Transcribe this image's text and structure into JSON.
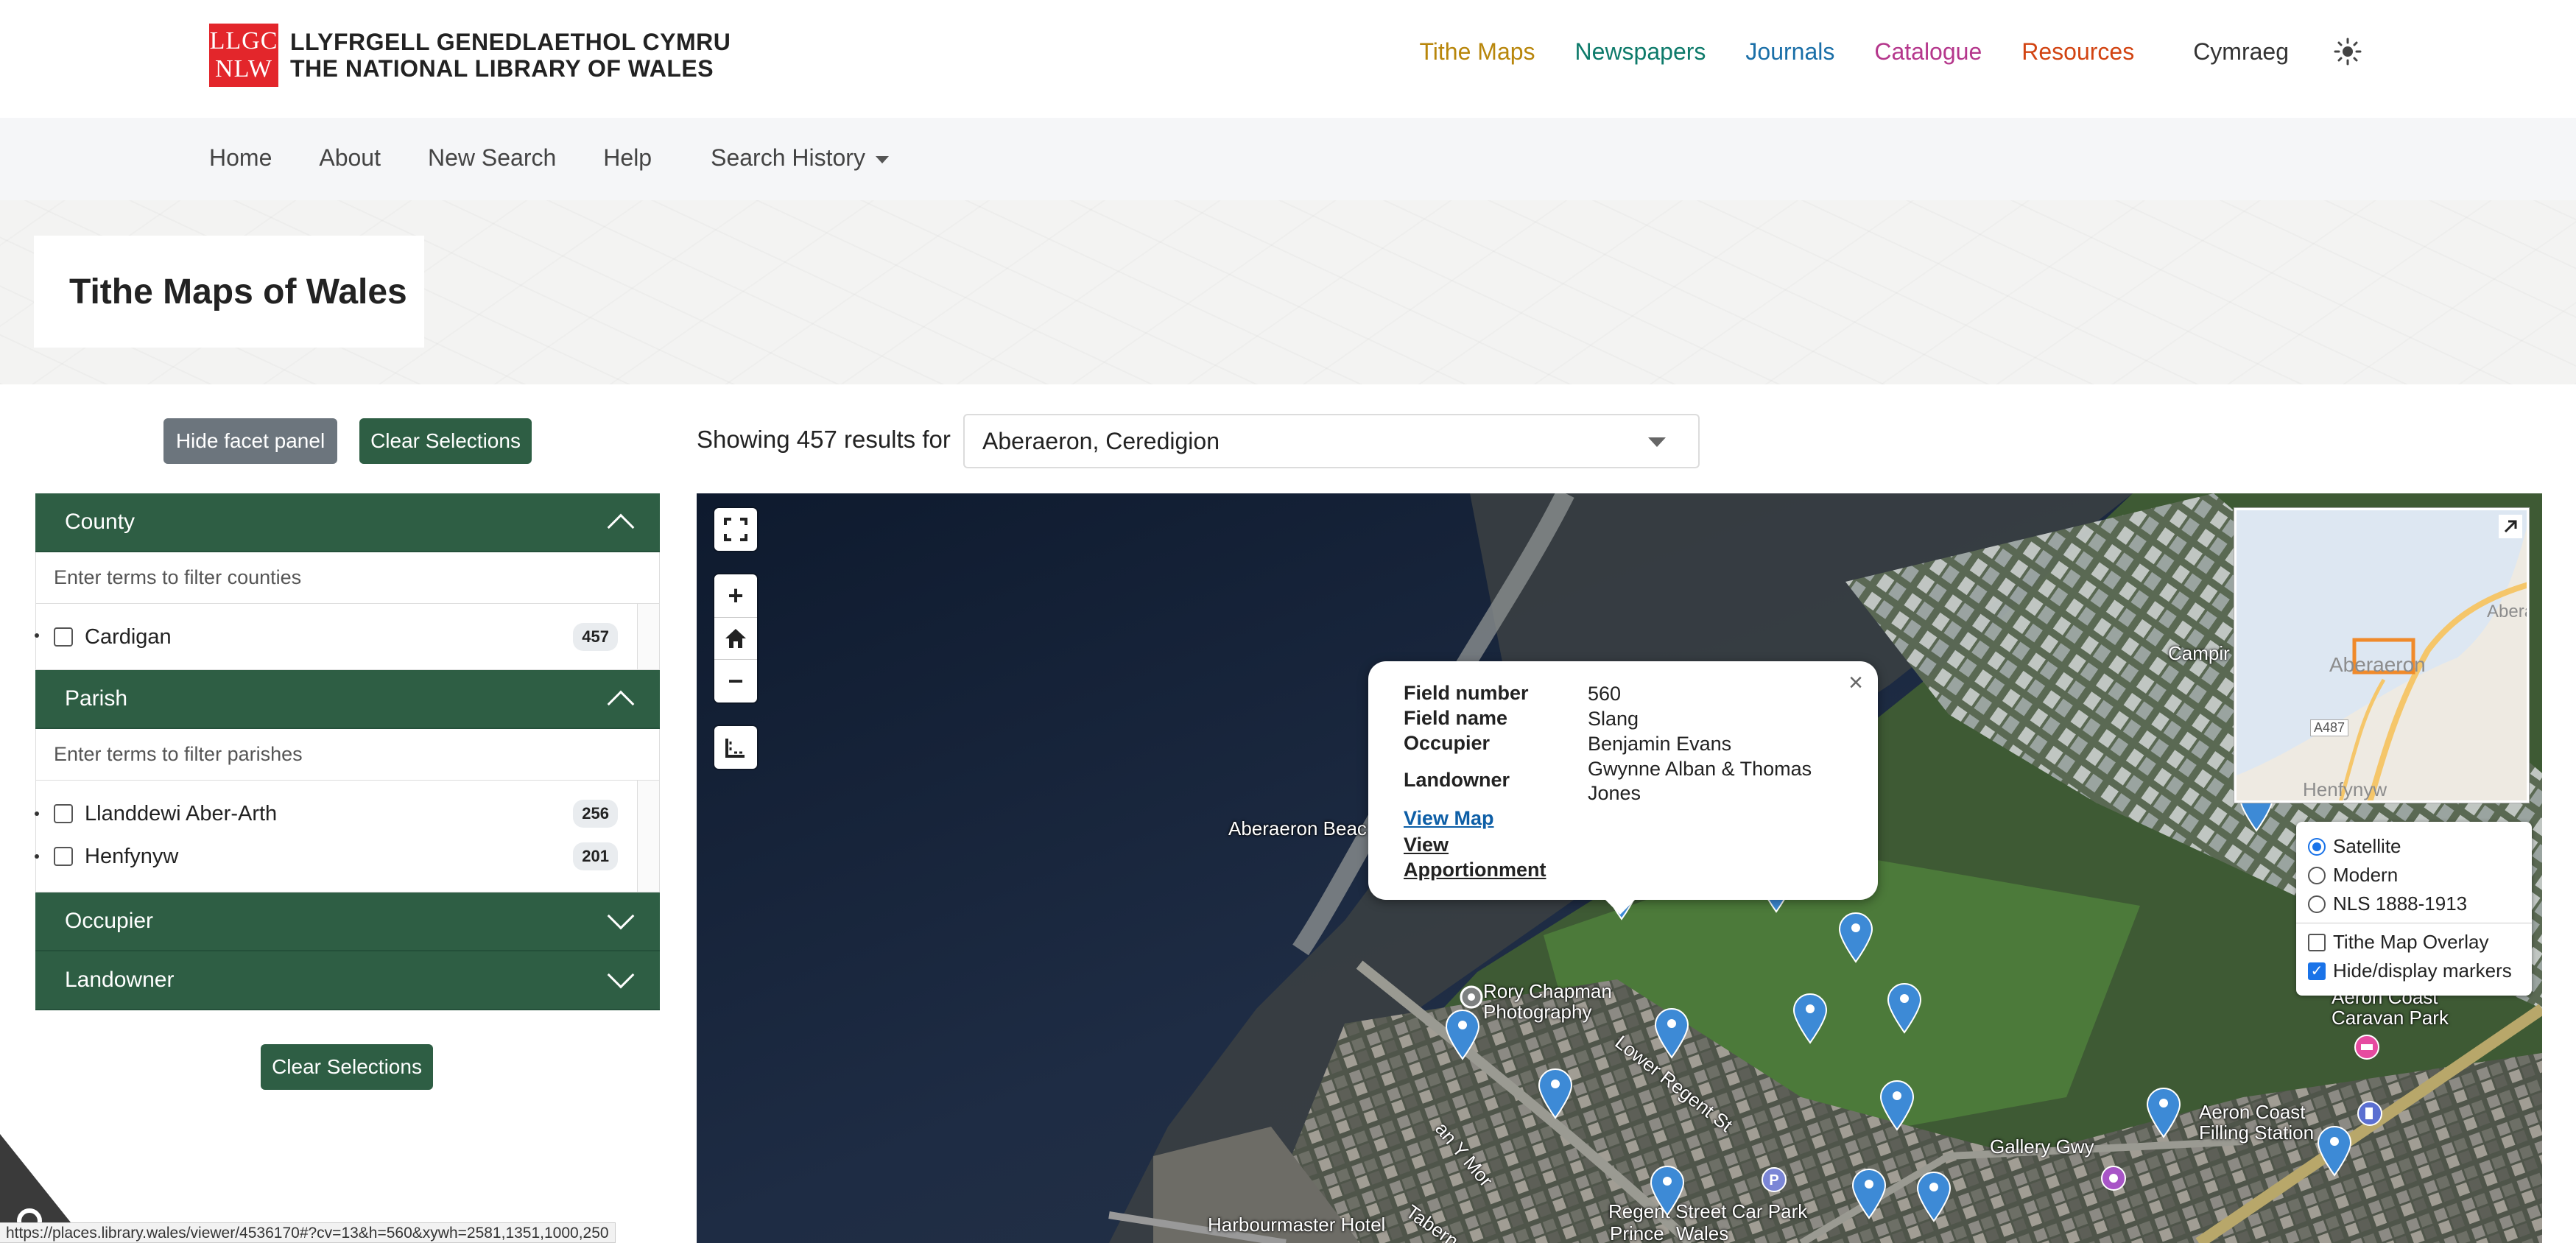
{
  "header": {
    "logo_top": "LLGC",
    "logo_bottom": "NLW",
    "org_line1": "LLYFRGELL GENEDLAETHOL CYMRU",
    "org_line2": "THE NATIONAL LIBRARY OF WALES",
    "nav": [
      {
        "label": "Tithe Maps",
        "color": "#b8860b"
      },
      {
        "label": "Newspapers",
        "color": "#0d7a6a"
      },
      {
        "label": "Journals",
        "color": "#1a6fa8"
      },
      {
        "label": "Catalogue",
        "color": "#b5378c"
      },
      {
        "label": "Resources",
        "color": "#d24412"
      }
    ],
    "language": "Cymraeg",
    "theme_icon": "sun-icon"
  },
  "subnav": {
    "items": [
      "Home",
      "About",
      "New Search",
      "Help"
    ],
    "history": "Search History"
  },
  "page": {
    "title": "Tithe Maps of Wales"
  },
  "buttons": {
    "hide_facets": "Hide facet panel",
    "clear": "Clear Selections",
    "clear_bottom": "Clear Selections"
  },
  "facets": {
    "county": {
      "title": "County",
      "placeholder": "Enter terms to filter counties",
      "items": [
        {
          "label": "Cardigan",
          "count": "457"
        }
      ]
    },
    "parish": {
      "title": "Parish",
      "placeholder": "Enter terms to filter parishes",
      "items": [
        {
          "label": "Llanddewi Aber-Arth",
          "count": "256"
        },
        {
          "label": "Henfynyw",
          "count": "201"
        }
      ]
    },
    "occupier": {
      "title": "Occupier"
    },
    "landowner": {
      "title": "Landowner"
    }
  },
  "results": {
    "label": "Showing 457 results for",
    "selected_place": "Aberaeron, Ceredigion"
  },
  "map": {
    "popup": {
      "field_number_label": "Field number",
      "field_number": "560",
      "field_name_label": "Field name",
      "field_name": "Slang",
      "occupier_label": "Occupier",
      "occupier": "Benjamin Evans",
      "landowner_label": "Landowner",
      "landowner": "Gwynne Alban & Thomas Jones",
      "view_map": "View Map",
      "view_apportionment": "View Apportionment"
    },
    "layers": {
      "satellite": "Satellite",
      "modern": "Modern",
      "nls": "NLS 1888-1913",
      "overlay": "Tithe Map Overlay",
      "markers": "Hide/display markers",
      "selected": "Satellite",
      "overlay_checked": false,
      "markers_checked": true
    },
    "minimap_labels": [
      "Aberaeron",
      "Aberai",
      "A487",
      "Henfynyw"
    ],
    "labels": {
      "beach": "Aberaeron Beac",
      "rory": "Rory Chapman\nPhotography",
      "lower_regent": "Lower Regent St",
      "campir": "Campir",
      "aeron_park": "Aeron Coast\nCaravan Park",
      "filling": "Aeron Coast\nFilling Station",
      "gallery": "Gallery Gwy",
      "harbourmaster": "Harbourmaster Hotel",
      "regent_car_park": "Regent Street Car Park",
      "prince": "Prince",
      "wales": "Wales",
      "cae_y_mor": "an Y Mor",
      "tabern": "Tabern"
    },
    "pin_color": "#3d8ad6"
  },
  "status_url": "https://places.library.wales/viewer/4536170#?cv=13&h=560&xywh=2581,1351,1000,250"
}
